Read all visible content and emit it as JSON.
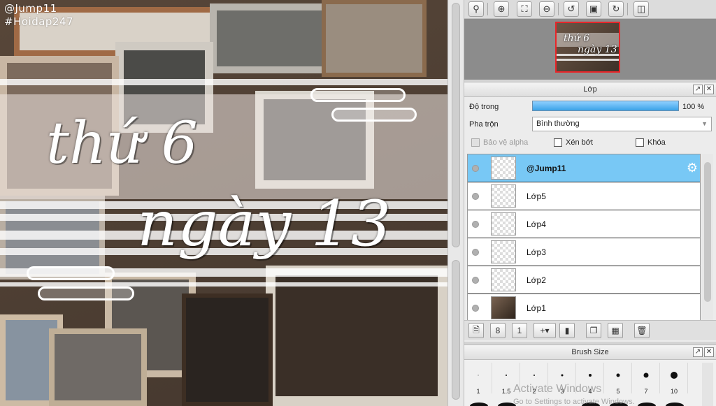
{
  "canvas": {
    "watermark_handle": "@Jump11",
    "watermark_tag": "#Hoidap247",
    "title_line1": "thứ 6",
    "title_line2": "ngày 13"
  },
  "toolbar": {
    "buttons": [
      {
        "icon": "zoom-fit-icon"
      },
      {
        "icon": "zoom-in-icon"
      },
      {
        "icon": "fit-window-icon"
      },
      {
        "icon": "zoom-out-icon"
      },
      {
        "icon": "rotate-left-icon"
      },
      {
        "icon": "actual-size-icon"
      },
      {
        "icon": "rotate-right-icon"
      },
      {
        "icon": "flip-icon"
      }
    ]
  },
  "layer_panel": {
    "title": "Lớp",
    "opacity_label": "Độ trong",
    "opacity_value": "100 %",
    "opacity_fraction": 1.0,
    "blend_label": "Pha trộn",
    "blend_value": "Bình thường",
    "protect_alpha_label": "Bảo vệ alpha",
    "clipping_label": "Xén bớt",
    "lock_label": "Khóa",
    "layers": [
      {
        "name": "@Jump11",
        "selected": true,
        "thumb": "transparent"
      },
      {
        "name": "Lớp5",
        "selected": false,
        "thumb": "transparent"
      },
      {
        "name": "Lớp4",
        "selected": false,
        "thumb": "transparent"
      },
      {
        "name": "Lớp3",
        "selected": false,
        "thumb": "transparent"
      },
      {
        "name": "Lớp2",
        "selected": false,
        "thumb": "transparent"
      },
      {
        "name": "Lớp1",
        "selected": false,
        "thumb": "photo"
      }
    ]
  },
  "brush_panel": {
    "title": "Brush Size",
    "sizes": [
      "1",
      "1.5",
      "2",
      "3",
      "4",
      "5",
      "7",
      "10"
    ],
    "activation_line1": "Activate Windows",
    "activation_line2": "Go to Settings to activate Windows."
  },
  "colors": {
    "selected_layer": "#78c8f5",
    "opacity_bar": "#3aa2e8",
    "navigator_border": "#e8262a"
  }
}
